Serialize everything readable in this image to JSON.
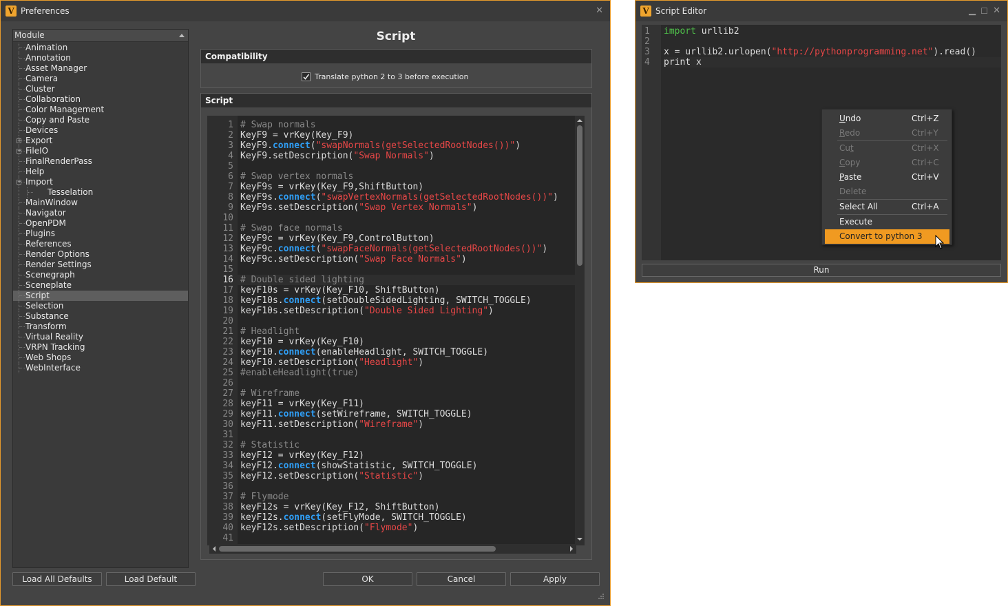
{
  "prefs": {
    "title": "Preferences",
    "module_header": "Module",
    "modules": [
      "Animation",
      "Annotation",
      "Asset Manager",
      "Camera",
      "Cluster",
      "Collaboration",
      "Color Management",
      "Copy and Paste",
      "Devices",
      "Export",
      "FileIO",
      "FinalRenderPass",
      "Help",
      "Import",
      "Tesselation",
      "MainWindow",
      "Navigator",
      "OpenPDM",
      "Plugins",
      "References",
      "Render Options",
      "Render Settings",
      "Scenegraph",
      "Sceneplate",
      "Script",
      "Selection",
      "Substance",
      "Transform",
      "Virtual Reality",
      "VRPN Tracking",
      "Web Shops",
      "WebInterface"
    ],
    "selected_module": "Script",
    "page_title": "Script",
    "compat_header": "Compatibility",
    "translate_label": "Translate python 2 to 3 before execution",
    "translate_checked": true,
    "script_header": "Script",
    "current_line": 16,
    "code_lines": [
      "# Swap normals",
      "KeyF9 = vrKey(Key_F9)",
      "KeyF9.connect(\"swapNormals(getSelectedRootNodes())\")",
      "KeyF9.setDescription(\"Swap Normals\")",
      "",
      "# Swap vertex normals",
      "KeyF9s = vrKey(Key_F9,ShiftButton)",
      "KeyF9s.connect(\"swapVertexNormals(getSelectedRootNodes())\")",
      "KeyF9s.setDescription(\"Swap Vertex Normals\")",
      "",
      "# Swap face normals",
      "KeyF9c = vrKey(Key_F9,ControlButton)",
      "KeyF9c.connect(\"swapFaceNormals(getSelectedRootNodes())\")",
      "KeyF9c.setDescription(\"Swap Face Normals\")",
      "",
      "# Double sided lighting",
      "keyF10s = vrKey(Key_F10, ShiftButton)",
      "keyF10s.connect(setDoubleSidedLighting, SWITCH_TOGGLE)",
      "keyF10s.setDescription(\"Double Sided Lighting\")",
      "",
      "# Headlight",
      "keyF10 = vrKey(Key_F10)",
      "keyF10.connect(enableHeadlight, SWITCH_TOGGLE)",
      "keyF10.setDescription(\"Headlight\")",
      "#enableHeadlight(true)",
      "",
      "# Wireframe",
      "keyF11 = vrKey(Key_F11)",
      "keyF11.connect(setWireframe, SWITCH_TOGGLE)",
      "keyF11.setDescription(\"Wireframe\")",
      "",
      "# Statistic",
      "keyF12 = vrKey(Key_F12)",
      "keyF12.connect(showStatistic, SWITCH_TOGGLE)",
      "keyF12.setDescription(\"Statistic\")",
      "",
      "# Flymode",
      "keyF12s = vrKey(Key_F12, ShiftButton)",
      "keyF12s.connect(setFlyMode, SWITCH_TOGGLE)",
      "keyF12s.setDescription(\"Flymode\")",
      ""
    ],
    "buttons": {
      "load_all_defaults": "Load All Defaults",
      "load_default": "Load Default",
      "ok": "OK",
      "cancel": "Cancel",
      "apply": "Apply"
    }
  },
  "editor": {
    "title": "Script Editor",
    "code_lines": [
      "import urllib2",
      "",
      "x = urllib2.urlopen(\"http://pythonprogramming.net\").read()",
      "print x"
    ],
    "run_label": "Run",
    "context_menu": [
      {
        "label": "Undo",
        "shortcut": "Ctrl+Z",
        "enabled": true,
        "underline": 0
      },
      {
        "label": "Redo",
        "shortcut": "Ctrl+Y",
        "enabled": false,
        "underline": 0
      },
      {
        "label": "Cut",
        "shortcut": "Ctrl+X",
        "enabled": false,
        "underline": 2
      },
      {
        "label": "Copy",
        "shortcut": "Ctrl+C",
        "enabled": false,
        "underline": 0
      },
      {
        "label": "Paste",
        "shortcut": "Ctrl+V",
        "enabled": true,
        "underline": 0
      },
      {
        "label": "Delete",
        "shortcut": "",
        "enabled": false,
        "underline": -1
      },
      {
        "label": "Select All",
        "shortcut": "Ctrl+A",
        "enabled": true,
        "underline": -1
      },
      {
        "label": "Execute",
        "shortcut": "",
        "enabled": true,
        "underline": -1
      },
      {
        "label": "Convert to python 3",
        "shortcut": "",
        "enabled": true,
        "highlighted": true,
        "underline": -1
      }
    ]
  },
  "colors": {
    "accent": "#f09a21",
    "window_border": "#e79b2c",
    "keyword": "#2f9ef5",
    "string": "#e84747",
    "comment": "#8a8a8a",
    "import_keyword": "#4fc04a"
  }
}
